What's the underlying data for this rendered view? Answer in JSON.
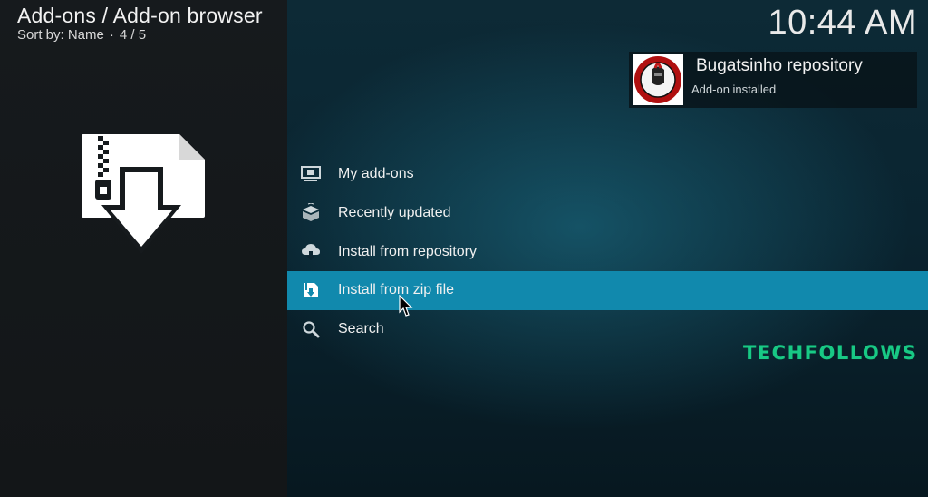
{
  "header": {
    "title": "Add-ons / Add-on browser",
    "sort_label": "Sort by: Name",
    "position": "4 / 5"
  },
  "clock": "10:44 AM",
  "notification": {
    "title": "Bugatsinho repository",
    "message": "Add-on installed",
    "icon": "repository-logo"
  },
  "main_icon": "zip-download-icon",
  "menu": {
    "items": [
      {
        "label": "My add-ons",
        "icon": "monitor-addons-icon"
      },
      {
        "label": "Recently updated",
        "icon": "box-updated-icon"
      },
      {
        "label": "Install from repository",
        "icon": "cloud-download-icon"
      },
      {
        "label": "Install from zip file",
        "icon": "zip-file-icon"
      },
      {
        "label": "Search",
        "icon": "search-icon"
      }
    ],
    "focused_index": 3
  },
  "watermark": "TECHFOLLOWS",
  "colors": {
    "focus": "#1189ad",
    "watermark": "#18c985",
    "left_pane": "#151a1c"
  }
}
